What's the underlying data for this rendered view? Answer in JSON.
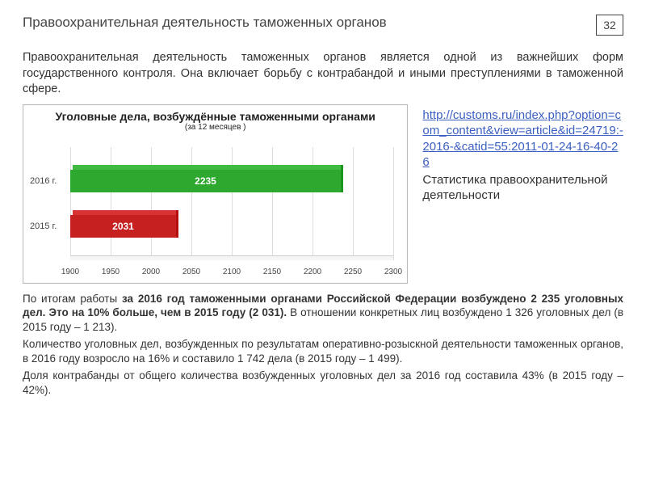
{
  "page_number": "32",
  "title": "Правоохранительная деятельность таможенных органов",
  "intro": "Правоохранительная деятельность таможенных органов является одной из важнейших форм государственного контроля. Она включает борьбу с контрабандой и иными преступлениями в таможенной сфере.",
  "chart_data": {
    "type": "bar",
    "orientation": "horizontal",
    "title": "Уголовные дела, возбуждённые таможенными органами",
    "subtitle": "(за 12 месяцев )",
    "categories": [
      "2016 г.",
      "2015 г."
    ],
    "values": [
      2235,
      2031
    ],
    "colors": [
      "#2fa82f",
      "#c62020"
    ],
    "xlim": [
      1900,
      2300
    ],
    "xticks": [
      1900,
      1950,
      2000,
      2050,
      2100,
      2150,
      2200,
      2250,
      2300
    ]
  },
  "link_url": "http://customs.ru/index.php?option=com_content&view=article&id=24719:-2016-&catid=55:2011-01-24-16-40-26",
  "stat_caption": "Статистика правоохранительной деятельности",
  "para1_lead": "По итогам работы ",
  "para1_bold": "за 2016 год таможенными органами Российской Федерации возбуждено 2 235 уголовных дел. Это на 10% больше, чем в 2015 году (2 031).",
  "para1_tail": " В отношении конкретных лиц возбуждено 1 326 уголовных дел (в 2015 году – 1 213).",
  "para2": "Количество уголовных дел, возбужденных по результатам оперативно-розыскной деятельности таможенных органов, в 2016 году возросло на 16% и составило 1 742 дела (в 2015 году –  1 499).",
  "para3": "Доля контрабанды от общего количества возбужденных уголовных дел за 2016 год составила 43% (в 2015 году –  42%)."
}
